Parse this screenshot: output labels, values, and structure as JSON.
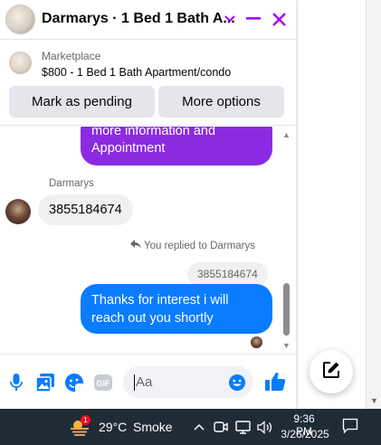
{
  "header": {
    "title": "Darmarys · 1 Bed 1 Bath A...",
    "accent": "#a200ff"
  },
  "marketplace": {
    "label": "Marketplace",
    "listing": "$800 - 1 Bed 1 Bath Apartment/condo",
    "mark_pending_label": "Mark as pending",
    "more_options_label": "More options"
  },
  "messages": {
    "outgoing_partial": [
      "more information and",
      "Appointment"
    ],
    "sender_name": "Darmarys",
    "incoming_text": "3855184674",
    "replied_note": "You replied to Darmarys",
    "quoted_text": "3855184674",
    "outgoing_last": [
      "Thanks for interest i will",
      "reach out you shortly"
    ],
    "colors": {
      "purple": "#8a2be2",
      "blue": "#0a7cff"
    }
  },
  "composer": {
    "placeholder": "Aa",
    "icons": [
      "microphone-icon",
      "gallery-icon",
      "sticker-icon",
      "gif-icon",
      "emoji-icon",
      "thumbs-up-icon"
    ]
  },
  "taskbar": {
    "weather_badge": "1",
    "temperature": "29°C",
    "condition": "Smoke",
    "time": "9:36 PM",
    "date": "3/26/2025"
  }
}
